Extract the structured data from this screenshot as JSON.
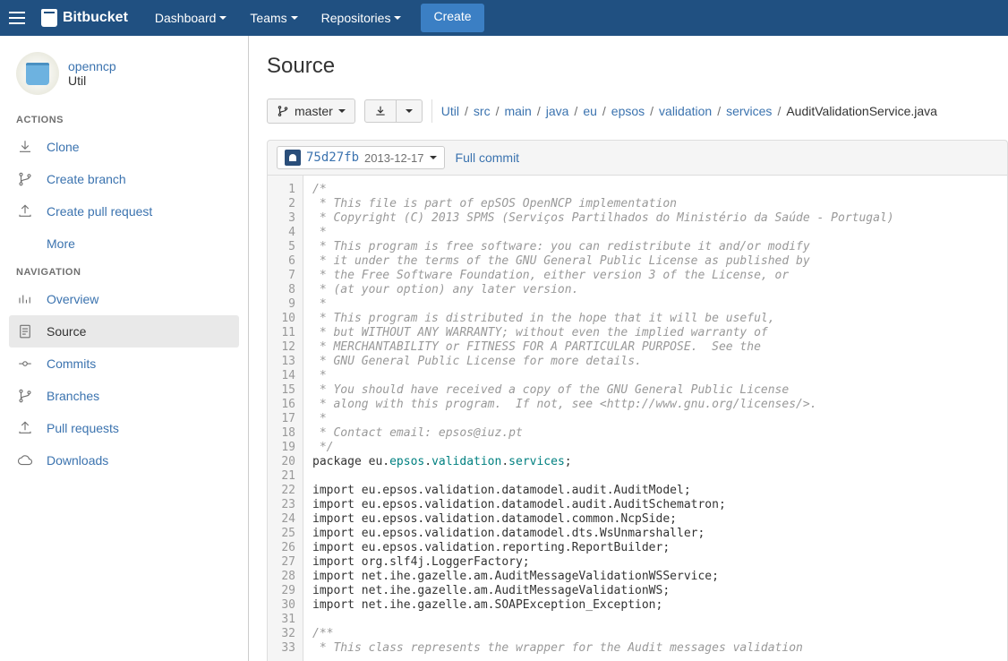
{
  "topnav": {
    "logo": "Bitbucket",
    "items": [
      "Dashboard",
      "Teams",
      "Repositories"
    ],
    "create": "Create"
  },
  "sidebar": {
    "repo": {
      "name": "openncp",
      "sub": "Util"
    },
    "actions_label": "ACTIONS",
    "actions": [
      {
        "id": "clone",
        "label": "Clone",
        "icon": "download-arrow"
      },
      {
        "id": "create-branch",
        "label": "Create branch",
        "icon": "branch"
      },
      {
        "id": "create-pr",
        "label": "Create pull request",
        "icon": "upload-box"
      },
      {
        "id": "more",
        "label": "More",
        "icon": ""
      }
    ],
    "navigation_label": "NAVIGATION",
    "navigation": [
      {
        "id": "overview",
        "label": "Overview",
        "icon": "bars"
      },
      {
        "id": "source",
        "label": "Source",
        "icon": "doc",
        "active": true
      },
      {
        "id": "commits",
        "label": "Commits",
        "icon": "commit"
      },
      {
        "id": "branches",
        "label": "Branches",
        "icon": "branch"
      },
      {
        "id": "pull-requests",
        "label": "Pull requests",
        "icon": "upload-box"
      },
      {
        "id": "downloads",
        "label": "Downloads",
        "icon": "cloud"
      }
    ]
  },
  "main": {
    "title": "Source",
    "branch": "master",
    "breadcrumb": {
      "parts": [
        "Util",
        "src",
        "main",
        "java",
        "eu",
        "epsos",
        "validation",
        "services"
      ],
      "current": "AuditValidationService.java"
    },
    "commit": {
      "hash": "75d27fb",
      "date": "2013-12-17",
      "full_commit": "Full commit"
    },
    "code_lines": [
      {
        "n": 1,
        "t": "/*",
        "c": "comment"
      },
      {
        "n": 2,
        "t": " * This file is part of epSOS OpenNCP implementation",
        "c": "comment"
      },
      {
        "n": 3,
        "t": " * Copyright (C) 2013 SPMS (Serviços Partilhados do Ministério da Saúde - Portugal)",
        "c": "comment"
      },
      {
        "n": 4,
        "t": " *",
        "c": "comment"
      },
      {
        "n": 5,
        "t": " * This program is free software: you can redistribute it and/or modify",
        "c": "comment"
      },
      {
        "n": 6,
        "t": " * it under the terms of the GNU General Public License as published by",
        "c": "comment"
      },
      {
        "n": 7,
        "t": " * the Free Software Foundation, either version 3 of the License, or",
        "c": "comment"
      },
      {
        "n": 8,
        "t": " * (at your option) any later version.",
        "c": "comment"
      },
      {
        "n": 9,
        "t": " *",
        "c": "comment"
      },
      {
        "n": 10,
        "t": " * This program is distributed in the hope that it will be useful,",
        "c": "comment"
      },
      {
        "n": 11,
        "t": " * but WITHOUT ANY WARRANTY; without even the implied warranty of",
        "c": "comment"
      },
      {
        "n": 12,
        "t": " * MERCHANTABILITY or FITNESS FOR A PARTICULAR PURPOSE.  See the",
        "c": "comment"
      },
      {
        "n": 13,
        "t": " * GNU General Public License for more details.",
        "c": "comment"
      },
      {
        "n": 14,
        "t": " *",
        "c": "comment"
      },
      {
        "n": 15,
        "t": " * You should have received a copy of the GNU General Public License",
        "c": "comment"
      },
      {
        "n": 16,
        "t": " * along with this program.  If not, see <http://www.gnu.org/licenses/>.",
        "c": "comment"
      },
      {
        "n": 17,
        "t": " *",
        "c": "comment"
      },
      {
        "n": 18,
        "t": " * Contact email: epsos@iuz.pt",
        "c": "comment"
      },
      {
        "n": 19,
        "t": " */",
        "c": "comment"
      },
      {
        "n": 20,
        "t": "package eu.epsos.validation.services;",
        "c": "pkg"
      },
      {
        "n": 21,
        "t": "",
        "c": ""
      },
      {
        "n": 22,
        "t": "import eu.epsos.validation.datamodel.audit.AuditModel;",
        "c": ""
      },
      {
        "n": 23,
        "t": "import eu.epsos.validation.datamodel.audit.AuditSchematron;",
        "c": ""
      },
      {
        "n": 24,
        "t": "import eu.epsos.validation.datamodel.common.NcpSide;",
        "c": ""
      },
      {
        "n": 25,
        "t": "import eu.epsos.validation.datamodel.dts.WsUnmarshaller;",
        "c": ""
      },
      {
        "n": 26,
        "t": "import eu.epsos.validation.reporting.ReportBuilder;",
        "c": ""
      },
      {
        "n": 27,
        "t": "import org.slf4j.LoggerFactory;",
        "c": ""
      },
      {
        "n": 28,
        "t": "import net.ihe.gazelle.am.AuditMessageValidationWSService;",
        "c": ""
      },
      {
        "n": 29,
        "t": "import net.ihe.gazelle.am.AuditMessageValidationWS;",
        "c": ""
      },
      {
        "n": 30,
        "t": "import net.ihe.gazelle.am.SOAPException_Exception;",
        "c": ""
      },
      {
        "n": 31,
        "t": "",
        "c": ""
      },
      {
        "n": 32,
        "t": "/**",
        "c": "comment"
      },
      {
        "n": 33,
        "t": " * This class represents the wrapper for the Audit messages validation",
        "c": "comment"
      }
    ]
  }
}
